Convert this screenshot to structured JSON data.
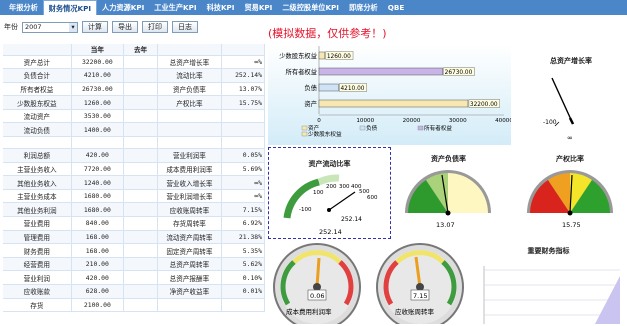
{
  "tabs": [
    "年报分析",
    "财务情况KPI",
    "人力资源KPI",
    "工业生产KPI",
    "科技KPI",
    "贸易KPI",
    "二级控股单位KPI",
    "即席分析",
    "QBE"
  ],
  "toolbar": {
    "year_label": "年份",
    "year_value": "2007",
    "calc": "计算",
    "export": "导出",
    "print": "打印",
    "log": "日志"
  },
  "notice": "(模拟数据，仅供参考！)",
  "table": {
    "headers": [
      "",
      "当年",
      "去年",
      "",
      "",
      ""
    ],
    "rows": [
      [
        "资产总计",
        "32200.00",
        "",
        "总资产增长率",
        "∞%"
      ],
      [
        "负债合计",
        "4210.00",
        "",
        "流动比率",
        "252.14%"
      ],
      [
        "所有者权益",
        "26730.00",
        "",
        "资产负债率",
        "13.07%"
      ],
      [
        "少数股东权益",
        "1260.00",
        "",
        "产权比率",
        "15.75%"
      ],
      [
        "流动资产",
        "3530.00",
        "",
        "",
        ""
      ],
      [
        "流动负债",
        "1400.00",
        "",
        "",
        ""
      ],
      [
        "",
        "",
        "",
        "",
        ""
      ],
      [
        "利润总额",
        "420.00",
        "",
        "营业利润率",
        "0.05%"
      ],
      [
        "主营业务收入",
        "7720.00",
        "",
        "成本费用利润率",
        "5.69%"
      ],
      [
        "其他业务收入",
        "1240.00",
        "",
        "营业收入增长率",
        "∞%"
      ],
      [
        "主营业务成本",
        "1680.00",
        "",
        "营业利润增长率",
        "∞%"
      ],
      [
        "其他业务利润",
        "1680.00",
        "",
        "应收账周转率",
        "7.15%"
      ],
      [
        "营业费用",
        "840.00",
        "",
        "存货周转率",
        "6.92%"
      ],
      [
        "管理费用",
        "168.00",
        "",
        "流动资产周转率",
        "21.38%"
      ],
      [
        "财务费用",
        "168.00",
        "",
        "固定资产周转率",
        "5.35%"
      ],
      [
        "经营费用",
        "210.00",
        "",
        "总资产周转率",
        "5.62%"
      ],
      [
        "营业利润",
        "420.00",
        "",
        "总资产报酬率",
        "0.10%"
      ],
      [
        "应收账款",
        "628.00",
        "",
        "净资产收益率",
        "0.01%"
      ],
      [
        "存货",
        "2100.00",
        "",
        "",
        ""
      ]
    ]
  },
  "bar_chart": {
    "type": "bar",
    "categories": [
      "少数股东权益",
      "所有者权益",
      "负债",
      "资产"
    ],
    "values": [
      1260,
      26730,
      4210,
      32200
    ],
    "value_labels": [
      "1260.00",
      "26730.00",
      "4210.00",
      "32200.00"
    ],
    "xticks": [
      "0",
      "10000",
      "20000",
      "30000",
      "40000"
    ],
    "xlim": [
      0,
      40000
    ],
    "legend": [
      "资产",
      "负债",
      "所有者权益",
      "少数股东权益"
    ],
    "colors": [
      "#f6e8b0",
      "#cfe3f7",
      "#c9b4e8",
      "#f6e8b0"
    ]
  },
  "gauges": {
    "growth": {
      "title": "总资产增长率",
      "label": "∞",
      "tick": "-100"
    },
    "liquidity": {
      "title": "资产流动比率",
      "value": "252.14",
      "ticks": [
        "-100",
        "100",
        "200",
        "300",
        "400",
        "500",
        "600"
      ]
    },
    "debt": {
      "title": "资产负债率",
      "value": "13.07"
    },
    "equity": {
      "title": "产权比率",
      "value": "15.75"
    },
    "cost": {
      "caption": "成本费用利润率",
      "value": "0.06"
    },
    "recv": {
      "caption": "应收账周转率",
      "value": "7.15"
    },
    "key": {
      "title": "重要财务指标"
    }
  },
  "chart_data": {
    "type": "bar",
    "categories": [
      "少数股东权益",
      "所有者权益",
      "负债",
      "资产"
    ],
    "values": [
      1260,
      26730,
      4210,
      32200
    ],
    "xlim": [
      0,
      40000
    ]
  }
}
